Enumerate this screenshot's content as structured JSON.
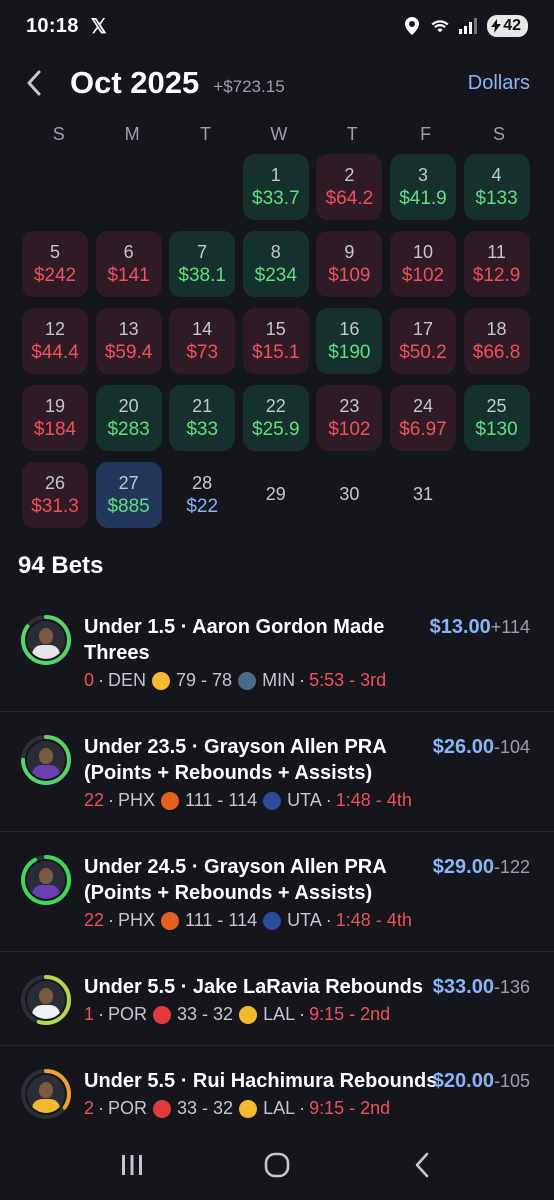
{
  "status": {
    "time": "10:18",
    "battery": "42"
  },
  "header": {
    "month": "Oct 2025",
    "total": "+$723.15",
    "units": "Dollars"
  },
  "weekdays": [
    "S",
    "M",
    "T",
    "W",
    "T",
    "F",
    "S"
  ],
  "days": [
    {
      "d": "",
      "a": "",
      "s": "empty"
    },
    {
      "d": "",
      "a": "",
      "s": "empty"
    },
    {
      "d": "",
      "a": "",
      "s": "empty"
    },
    {
      "d": "1",
      "a": "$33.7",
      "s": "win"
    },
    {
      "d": "2",
      "a": "$64.2",
      "s": "loss"
    },
    {
      "d": "3",
      "a": "$41.9",
      "s": "win"
    },
    {
      "d": "4",
      "a": "$133",
      "s": "win"
    },
    {
      "d": "5",
      "a": "$242",
      "s": "loss"
    },
    {
      "d": "6",
      "a": "$141",
      "s": "loss"
    },
    {
      "d": "7",
      "a": "$38.1",
      "s": "win"
    },
    {
      "d": "8",
      "a": "$234",
      "s": "win"
    },
    {
      "d": "9",
      "a": "$109",
      "s": "loss"
    },
    {
      "d": "10",
      "a": "$102",
      "s": "loss"
    },
    {
      "d": "11",
      "a": "$12.9",
      "s": "loss"
    },
    {
      "d": "12",
      "a": "$44.4",
      "s": "loss"
    },
    {
      "d": "13",
      "a": "$59.4",
      "s": "loss"
    },
    {
      "d": "14",
      "a": "$73",
      "s": "loss"
    },
    {
      "d": "15",
      "a": "$15.1",
      "s": "loss"
    },
    {
      "d": "16",
      "a": "$190",
      "s": "win"
    },
    {
      "d": "17",
      "a": "$50.2",
      "s": "loss"
    },
    {
      "d": "18",
      "a": "$66.8",
      "s": "loss"
    },
    {
      "d": "19",
      "a": "$184",
      "s": "loss"
    },
    {
      "d": "20",
      "a": "$283",
      "s": "win"
    },
    {
      "d": "21",
      "a": "$33",
      "s": "win"
    },
    {
      "d": "22",
      "a": "$25.9",
      "s": "win"
    },
    {
      "d": "23",
      "a": "$102",
      "s": "loss"
    },
    {
      "d": "24",
      "a": "$6.97",
      "s": "loss"
    },
    {
      "d": "25",
      "a": "$130",
      "s": "win"
    },
    {
      "d": "26",
      "a": "$31.3",
      "s": "loss"
    },
    {
      "d": "27",
      "a": "$885",
      "s": "sel"
    },
    {
      "d": "28",
      "a": "$22",
      "s": "pend"
    },
    {
      "d": "29",
      "a": "",
      "s": "empty"
    },
    {
      "d": "30",
      "a": "",
      "s": "empty"
    },
    {
      "d": "31",
      "a": "",
      "s": "empty"
    }
  ],
  "bets_title": "94 Bets",
  "bets": [
    {
      "title": "Under 1.5 · Aaron Gordon Made Threes",
      "stat": "0",
      "away": "DEN",
      "score": "79 - 78",
      "home": "MIN",
      "clock": "5:53 - 3rd",
      "stake": "$13.00",
      "odds": "+114",
      "away_color": "#f5b932",
      "home_color": "#4a6a8a",
      "shirt_color": "#e6e6ea"
    },
    {
      "title": "Under 23.5 · Grayson Allen PRA (Points + Rebounds + Assists)",
      "stat": "22",
      "away": "PHX",
      "score": "111 - 114",
      "home": "UTA",
      "clock": "1:48 - 4th",
      "stake": "$26.00",
      "odds": "-104",
      "away_color": "#e56020",
      "home_color": "#2b4b9c",
      "shirt_color": "#6a3fb0"
    },
    {
      "title": "Under 24.5 · Grayson Allen PRA (Points + Rebounds + Assists)",
      "stat": "22",
      "away": "PHX",
      "score": "111 - 114",
      "home": "UTA",
      "clock": "1:48 - 4th",
      "stake": "$29.00",
      "odds": "-122",
      "away_color": "#e56020",
      "home_color": "#2b4b9c",
      "shirt_color": "#6a3fb0"
    },
    {
      "title": "Under 5.5 · Jake LaRavia Rebounds",
      "stat": "1",
      "away": "POR",
      "score": "33 - 32",
      "home": "LAL",
      "clock": "9:15 - 2nd",
      "stake": "$33.00",
      "odds": "-136",
      "away_color": "#e03a3e",
      "home_color": "#f2b82e",
      "shirt_color": "#f0f0f2"
    },
    {
      "title": "Under 5.5 · Rui Hachimura Rebounds",
      "stat": "2",
      "away": "POR",
      "score": "33 - 32",
      "home": "LAL",
      "clock": "9:15 - 2nd",
      "stake": "$20.00",
      "odds": "-105",
      "away_color": "#e03a3e",
      "home_color": "#f2b82e",
      "shirt_color": "#f2b82e"
    }
  ],
  "ring_levels": [
    0.85,
    0.75,
    0.92,
    0.55,
    0.35
  ],
  "ring_colors": [
    "#56d46a",
    "#56d46a",
    "#3ed85a",
    "#b5d845",
    "#f0a030"
  ]
}
